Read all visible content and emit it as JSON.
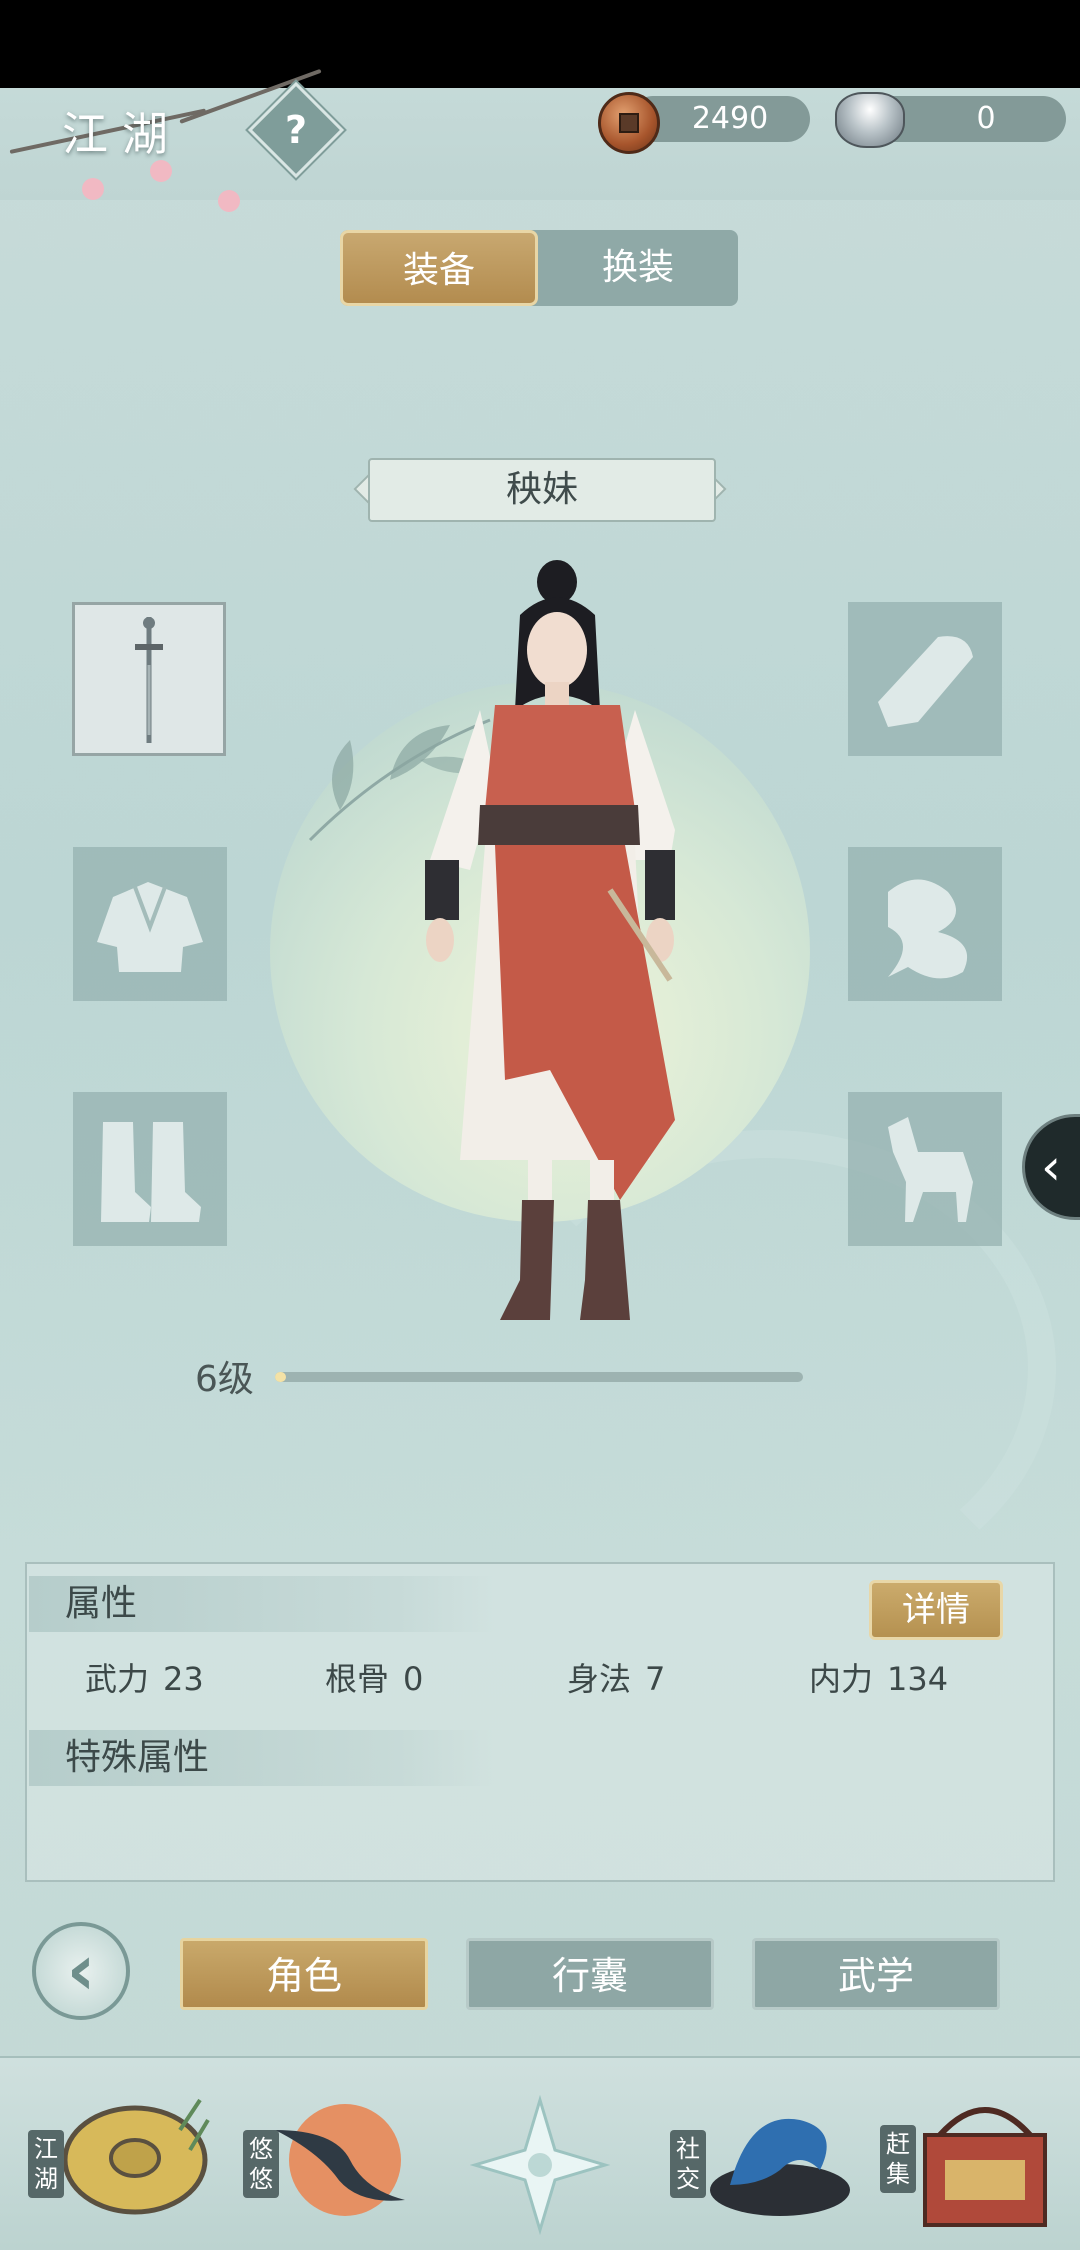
{
  "header": {
    "region_title": "江湖",
    "help_symbol": "?",
    "copper_coins": "2490",
    "silver_ingots": "0"
  },
  "tabs": {
    "equip": "装备",
    "outfit": "换装"
  },
  "character": {
    "name": "秧妹",
    "level_label": "6级",
    "exp_fraction": 0.02
  },
  "slots": {
    "weapon": "sword-icon",
    "left": [
      "sword-icon",
      "robe-icon",
      "boots-icon"
    ],
    "right": [
      "bracer-icon",
      "cloud-token-icon",
      "horse-icon"
    ]
  },
  "attributes": {
    "title": "属性",
    "details_button": "详情",
    "stats": [
      {
        "label": "武力",
        "value": "23"
      },
      {
        "label": "根骨",
        "value": "0"
      },
      {
        "label": "身法",
        "value": "7"
      },
      {
        "label": "内力",
        "value": "134"
      }
    ],
    "special_title": "特殊属性"
  },
  "bottom_tabs": {
    "role": "角色",
    "bag": "行囊",
    "martial": "武学"
  },
  "nav": [
    {
      "label": "江湖",
      "icon": "straw-hat-icon"
    },
    {
      "label": "悠悠",
      "icon": "swallow-icon"
    },
    {
      "label": "",
      "icon": "compass-star-icon"
    },
    {
      "label": "社交",
      "icon": "wave-bowl-icon"
    },
    {
      "label": "赶集",
      "icon": "market-box-icon"
    }
  ],
  "colors": {
    "gold_accent": "#b8914f",
    "teal_panel": "#8ea7a5",
    "background": "#c3d8d5"
  }
}
